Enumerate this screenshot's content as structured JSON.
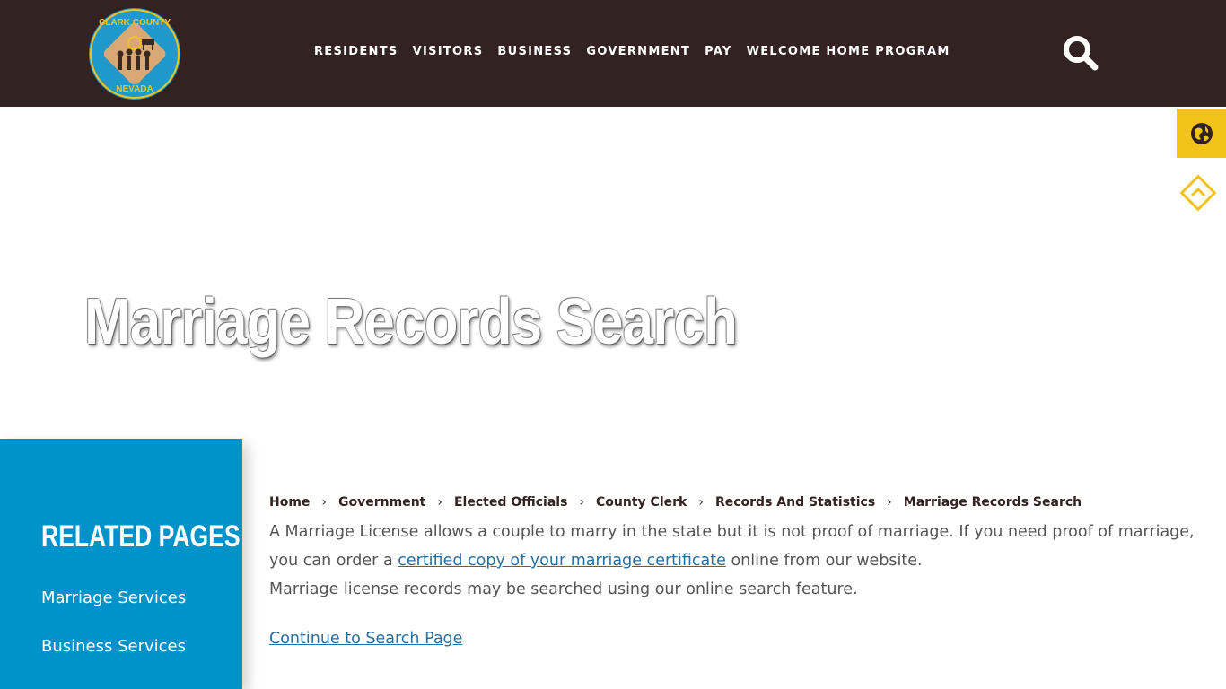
{
  "header": {
    "logo_text_top": "CLARK COUNTY",
    "logo_text_bottom": "NEVADA",
    "nav": [
      "RESIDENTS",
      "VISITORS",
      "BUSINESS",
      "GOVERNMENT",
      "PAY",
      "WELCOME HOME PROGRAM"
    ],
    "search_icon": "search-icon"
  },
  "widgets": {
    "translate_icon": "globe-icon",
    "back_to_top_icon": "chevron-up-diamond-icon",
    "accent_color": "#f3c21b"
  },
  "hero": {
    "title": "Marriage Records Search"
  },
  "sidebar": {
    "title": "RELATED PAGES",
    "links": [
      "Marriage Services",
      "Business Services"
    ]
  },
  "breadcrumb": [
    "Home",
    "Government",
    "Elected Officials",
    "County Clerk",
    "Records And Statistics",
    "Marriage Records Search"
  ],
  "content": {
    "p1_before": "A Marriage License allows a couple to marry in the state but it is not proof of marriage.  If you need proof of marriage, you can order a ",
    "p1_link": "certified copy of your marriage certificate",
    "p1_after": " online from our website.",
    "p2": "Marriage license records may be searched using our online search feature.",
    "continue_link": "Continue to Search Page"
  },
  "colors": {
    "header_bg": "#322222",
    "sidebar_bg": "#0093c9",
    "link": "#2a6e9e"
  }
}
